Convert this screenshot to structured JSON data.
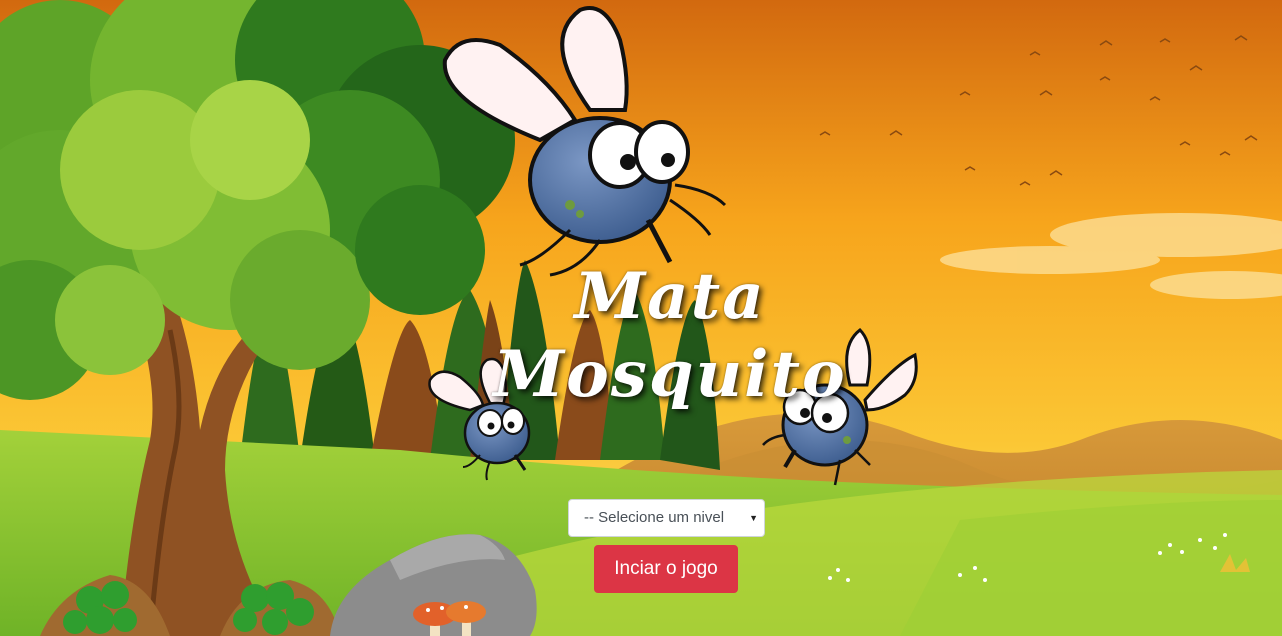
{
  "game": {
    "title_line1": "Mata",
    "title_line2": "Mosquito"
  },
  "level_select": {
    "selected": "-- Selecione um nivel",
    "caret_icon": "caret-down-icon"
  },
  "start_button": {
    "label": "Inciar o jogo"
  },
  "colors": {
    "sky_top": "#d96f0e",
    "sky_bottom": "#fbc233",
    "grass": "#7cc232",
    "button_red": "#dc3545",
    "mosquito_body": "#4a6fa5"
  }
}
